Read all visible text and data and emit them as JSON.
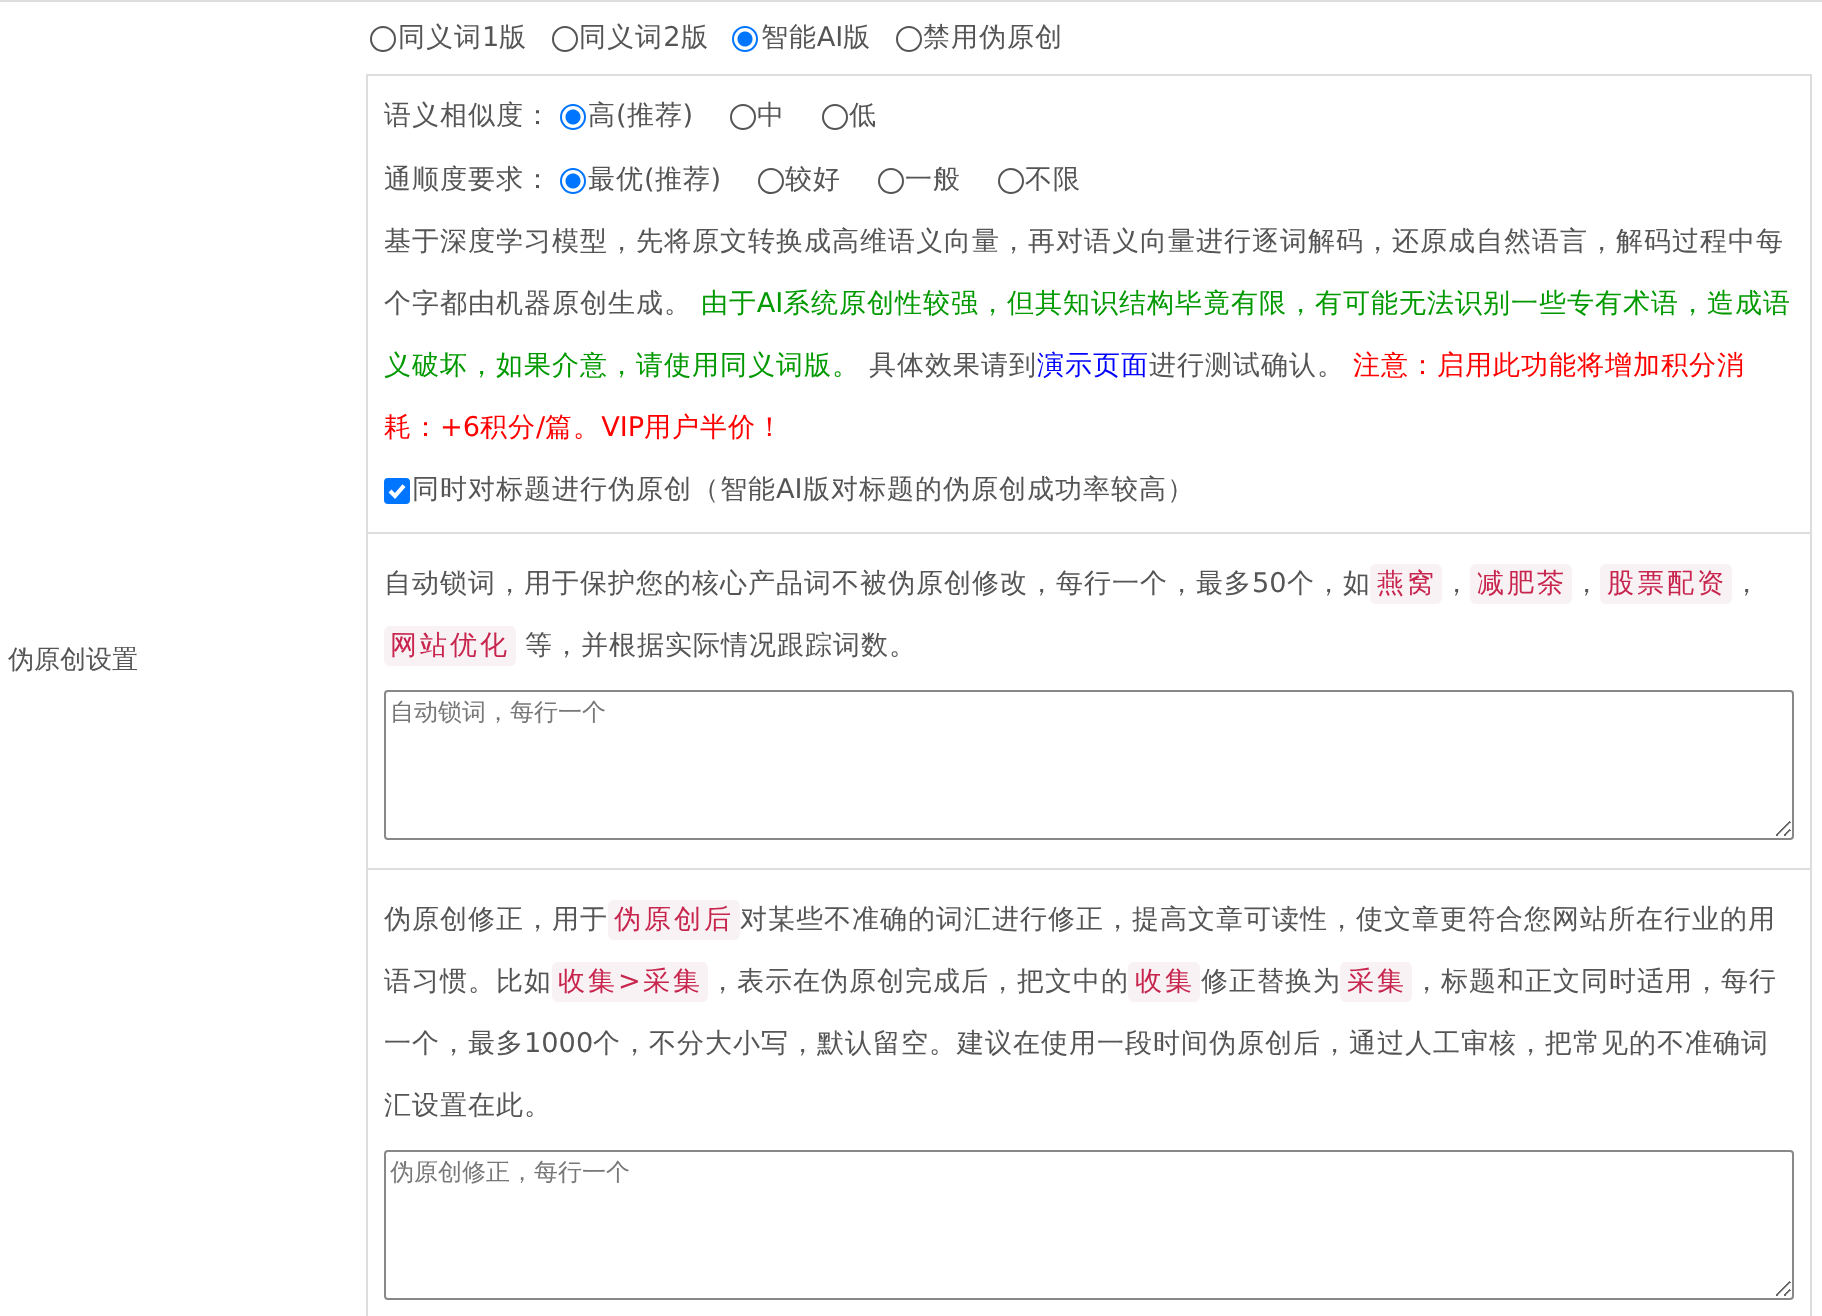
{
  "side_label": "伪原创设置",
  "modes": [
    {
      "label": "同义词1版",
      "selected": false
    },
    {
      "label": "同义词2版",
      "selected": false
    },
    {
      "label": "智能AI版",
      "selected": true
    },
    {
      "label": "禁用伪原创",
      "selected": false
    }
  ],
  "similarity": {
    "label": "语义相似度：",
    "options": [
      {
        "label": "高(推荐)",
        "selected": true
      },
      {
        "label": "中",
        "selected": false
      },
      {
        "label": "低",
        "selected": false
      }
    ]
  },
  "fluency": {
    "label": "通顺度要求：",
    "options": [
      {
        "label": "最优(推荐)",
        "selected": true
      },
      {
        "label": "较好",
        "selected": false
      },
      {
        "label": "一般",
        "selected": false
      },
      {
        "label": "不限",
        "selected": false
      }
    ]
  },
  "description": [
    {
      "kind": "plain",
      "text": "基于深度学习模型，先将原文转换成高维语义向量，再对语义向量进行逐词解码，还原成自然语言，解码过程中每个字都由机器原创生成。 "
    },
    {
      "kind": "green",
      "text": "由于AI系统原创性较强，但其知识结构毕竟有限，有可能无法识别一些专有术语，造成语义破坏，如果介意，请使用同义词版。"
    },
    {
      "kind": "plain",
      "text": " 具体效果请到"
    },
    {
      "kind": "link",
      "text": "演示页面"
    },
    {
      "kind": "plain",
      "text": "进行测试确认。 "
    },
    {
      "kind": "red",
      "text": "注意：启用此功能将增加积分消耗：+6积分/篇。VIP用户半价！"
    }
  ],
  "title_option": {
    "label": "同时对标题进行伪原创（智能AI版对标题的伪原创成功率较高）",
    "checked": true
  },
  "lock": {
    "text": [
      {
        "kind": "plain",
        "text": "自动锁词，用于保护您的核心产品词不被伪原创修改，每行一个，最多50个，如"
      },
      {
        "kind": "tag",
        "text": "燕窝"
      },
      {
        "kind": "plain",
        "text": "，"
      },
      {
        "kind": "tag",
        "text": "减肥茶"
      },
      {
        "kind": "plain",
        "text": "，"
      },
      {
        "kind": "tag",
        "text": "股票配资"
      },
      {
        "kind": "plain",
        "text": "，"
      },
      {
        "kind": "tag",
        "text": "网站优化"
      },
      {
        "kind": "plain",
        "text": " 等，并根据实际情况跟踪词数。"
      }
    ],
    "placeholder": "自动锁词，每行一个"
  },
  "fix": {
    "text": [
      {
        "kind": "plain",
        "text": "伪原创修正，用于"
      },
      {
        "kind": "tag",
        "text": "伪原创后"
      },
      {
        "kind": "plain",
        "text": "对某些不准确的词汇进行修正，提高文章可读性，使文章更符合您网站所在行业的用语习惯。比如"
      },
      {
        "kind": "tag",
        "text": "收集>采集"
      },
      {
        "kind": "plain",
        "text": "，表示在伪原创完成后，把文中的"
      },
      {
        "kind": "tag",
        "text": "收集"
      },
      {
        "kind": "plain",
        "text": "修正替换为"
      },
      {
        "kind": "tag",
        "text": "采集"
      },
      {
        "kind": "plain",
        "text": "，标题和正文同时适用，每行一个，最多1000个，不分大小写，默认留空。建议在使用一段时间伪原创后，通过人工审核，把常见的不准确词汇设置在此。"
      }
    ],
    "placeholder": "伪原创修正，每行一个"
  }
}
